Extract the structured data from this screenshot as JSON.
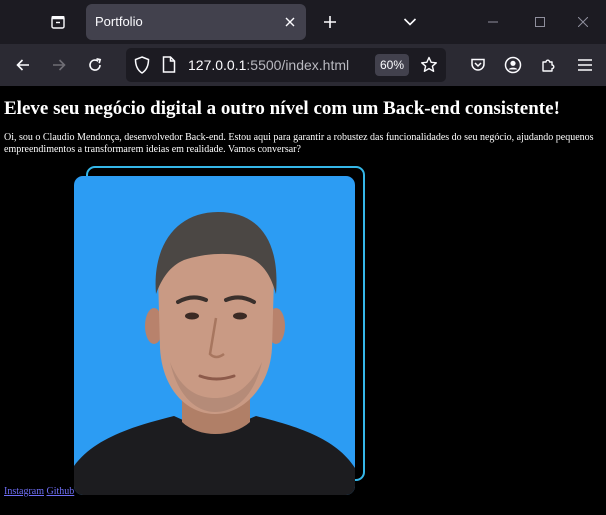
{
  "browser": {
    "tab_title": "Portfolio",
    "url_host": "127.0.0.1",
    "url_rest": ":5500/index.html",
    "zoom": "60%"
  },
  "page": {
    "headline": "Eleve seu negócio digital a outro nível com um Back-end consistente!",
    "intro": "Oi, sou o Claudio Mendonça, desenvolvedor Back-end. Estou aqui para garantir a robustez das funcionalidades do seu negócio, ajudando pequenos empreendimentos a transformarem ideias em realidade. Vamos conversar?",
    "links": [
      {
        "label": "Instagram"
      },
      {
        "label": "Github"
      }
    ]
  },
  "colors": {
    "accent_border": "#35b7e8",
    "photo_background": "#2c9cf3",
    "link": "#6e6ef5"
  }
}
